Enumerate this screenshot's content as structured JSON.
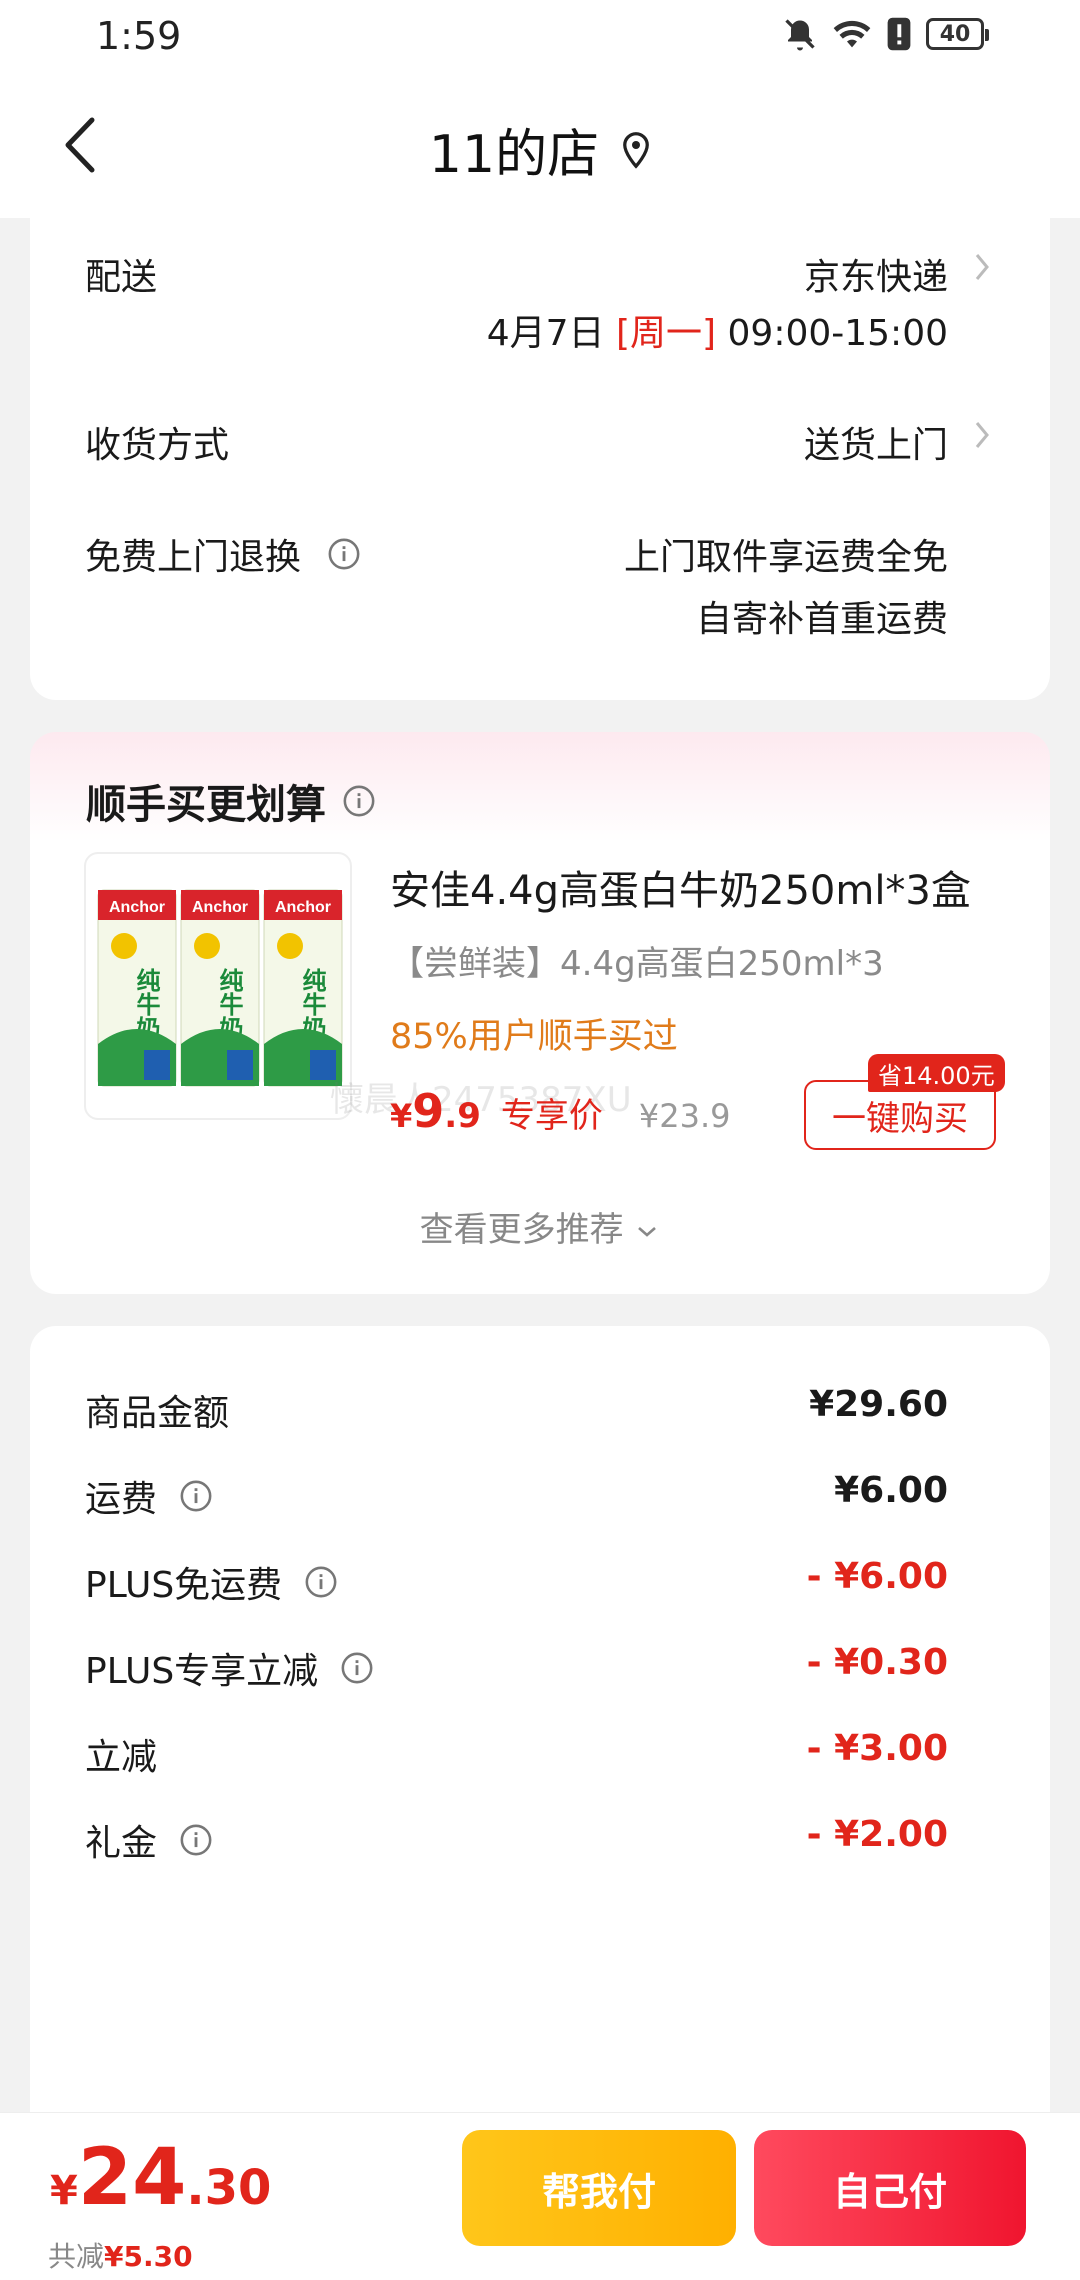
{
  "status_bar": {
    "time": "1:59",
    "battery": "40"
  },
  "nav": {
    "title": "11的店"
  },
  "delivery": {
    "label": "配送",
    "carrier": "京东快递",
    "date": "4月7日",
    "weekday": "[周一]",
    "time_range": "09:00-15:00"
  },
  "receive": {
    "label": "收货方式",
    "value": "送货上门"
  },
  "return": {
    "label": "免费上门退换",
    "line1": "上门取件享运费全免",
    "line2": "自寄补首重运费"
  },
  "recommend": {
    "title": "顺手买更划算",
    "product_name": "安佳4.4g高蛋白牛奶250ml*3盒",
    "spec": "【尝鲜装】4.4g高蛋白250ml*3",
    "tip": "85%用户顺手买过",
    "price_yen": "¥",
    "price_int": "9",
    "price_dec": ".9",
    "price_tag": "专享价",
    "price_old": "¥23.9",
    "save_badge": "省14.00元",
    "buy_label": "一键购买",
    "watermark": "懷晨人2475387XU",
    "more_label": "查看更多推荐",
    "image_brand": "Anchor",
    "image_label": "纯牛奶"
  },
  "fees": [
    {
      "label": "商品金额",
      "value": "¥29.60",
      "info": false,
      "discount": false
    },
    {
      "label": "运费",
      "value": "¥6.00",
      "info": true,
      "discount": false
    },
    {
      "label": "PLUS免运费",
      "value": "- ¥6.00",
      "info": true,
      "discount": true
    },
    {
      "label": "PLUS专享立减",
      "value": "- ¥0.30",
      "info": true,
      "discount": true
    },
    {
      "label": "立减",
      "value": "- ¥3.00",
      "info": false,
      "discount": true
    },
    {
      "label": "礼金",
      "value": "- ¥2.00",
      "info": true,
      "discount": true
    }
  ],
  "bottom": {
    "total_yen": "¥",
    "total_int": "24",
    "total_dec": ".30",
    "save_prefix": "共减",
    "save_value": "¥5.30",
    "help_pay": "帮我付",
    "self_pay": "自己付"
  },
  "colors": {
    "accent_red": "#e1251b",
    "tip_orange": "#e07b1a",
    "help_pay_yellow": "#ffb000",
    "self_pay_red": "#f0152f"
  }
}
